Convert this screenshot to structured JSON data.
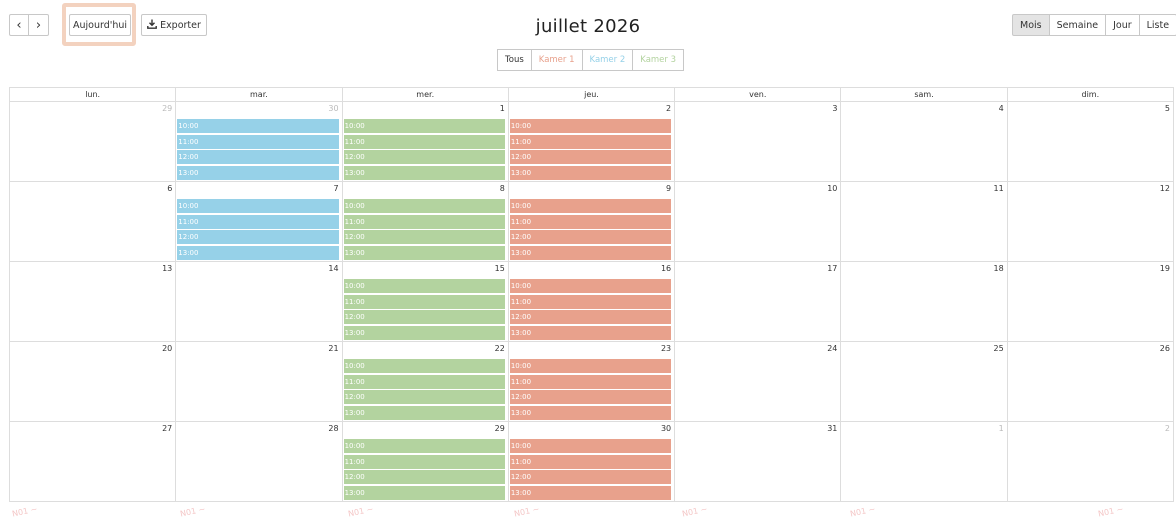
{
  "toolbar": {
    "prev_label": "‹",
    "next_label": "›",
    "today_label": "Aujourd'hui",
    "export_label": "Exporter",
    "title": "juillet 2026",
    "views": [
      "Mois",
      "Semaine",
      "Jour",
      "Liste"
    ],
    "active_view": "Mois"
  },
  "filters": [
    {
      "label": "Tous",
      "color": "#333333"
    },
    {
      "label": "Kamer 1",
      "color": "#e8a18c"
    },
    {
      "label": "Kamer 2",
      "color": "#96d1e8"
    },
    {
      "label": "Kamer 3",
      "color": "#b3d39f"
    }
  ],
  "calendar": {
    "headers": [
      "lun.",
      "mar.",
      "mer.",
      "jeu.",
      "ven.",
      "sam.",
      "dim."
    ],
    "event_times": [
      "10:00",
      "11:00",
      "12:00",
      "13:00"
    ],
    "weeks": [
      [
        {
          "day": "29",
          "other": true,
          "room": null
        },
        {
          "day": "30",
          "other": true,
          "room": "k2"
        },
        {
          "day": "1",
          "other": false,
          "room": "k3"
        },
        {
          "day": "2",
          "other": false,
          "room": "k1"
        },
        {
          "day": "3",
          "other": false,
          "room": null
        },
        {
          "day": "4",
          "other": false,
          "room": null
        },
        {
          "day": "5",
          "other": false,
          "room": null
        }
      ],
      [
        {
          "day": "6",
          "other": false,
          "room": null
        },
        {
          "day": "7",
          "other": false,
          "room": "k2"
        },
        {
          "day": "8",
          "other": false,
          "room": "k3"
        },
        {
          "day": "9",
          "other": false,
          "room": "k1"
        },
        {
          "day": "10",
          "other": false,
          "room": null
        },
        {
          "day": "11",
          "other": false,
          "room": null
        },
        {
          "day": "12",
          "other": false,
          "room": null
        }
      ],
      [
        {
          "day": "13",
          "other": false,
          "room": null
        },
        {
          "day": "14",
          "other": false,
          "room": null
        },
        {
          "day": "15",
          "other": false,
          "room": "k3"
        },
        {
          "day": "16",
          "other": false,
          "room": "k1"
        },
        {
          "day": "17",
          "other": false,
          "room": null
        },
        {
          "day": "18",
          "other": false,
          "room": null
        },
        {
          "day": "19",
          "other": false,
          "room": null
        }
      ],
      [
        {
          "day": "20",
          "other": false,
          "room": null
        },
        {
          "day": "21",
          "other": false,
          "room": null
        },
        {
          "day": "22",
          "other": false,
          "room": "k3"
        },
        {
          "day": "23",
          "other": false,
          "room": "k1"
        },
        {
          "day": "24",
          "other": false,
          "room": null
        },
        {
          "day": "25",
          "other": false,
          "room": null
        },
        {
          "day": "26",
          "other": false,
          "room": null
        }
      ],
      [
        {
          "day": "27",
          "other": false,
          "room": null
        },
        {
          "day": "28",
          "other": false,
          "room": null
        },
        {
          "day": "29",
          "other": false,
          "room": "k3"
        },
        {
          "day": "30",
          "other": false,
          "room": "k1"
        },
        {
          "day": "31",
          "other": false,
          "room": null
        },
        {
          "day": "1",
          "other": true,
          "room": null
        },
        {
          "day": "2",
          "other": true,
          "room": null
        }
      ]
    ]
  },
  "watermark_text": "N01 ~",
  "icons": {
    "export": "download-icon"
  }
}
